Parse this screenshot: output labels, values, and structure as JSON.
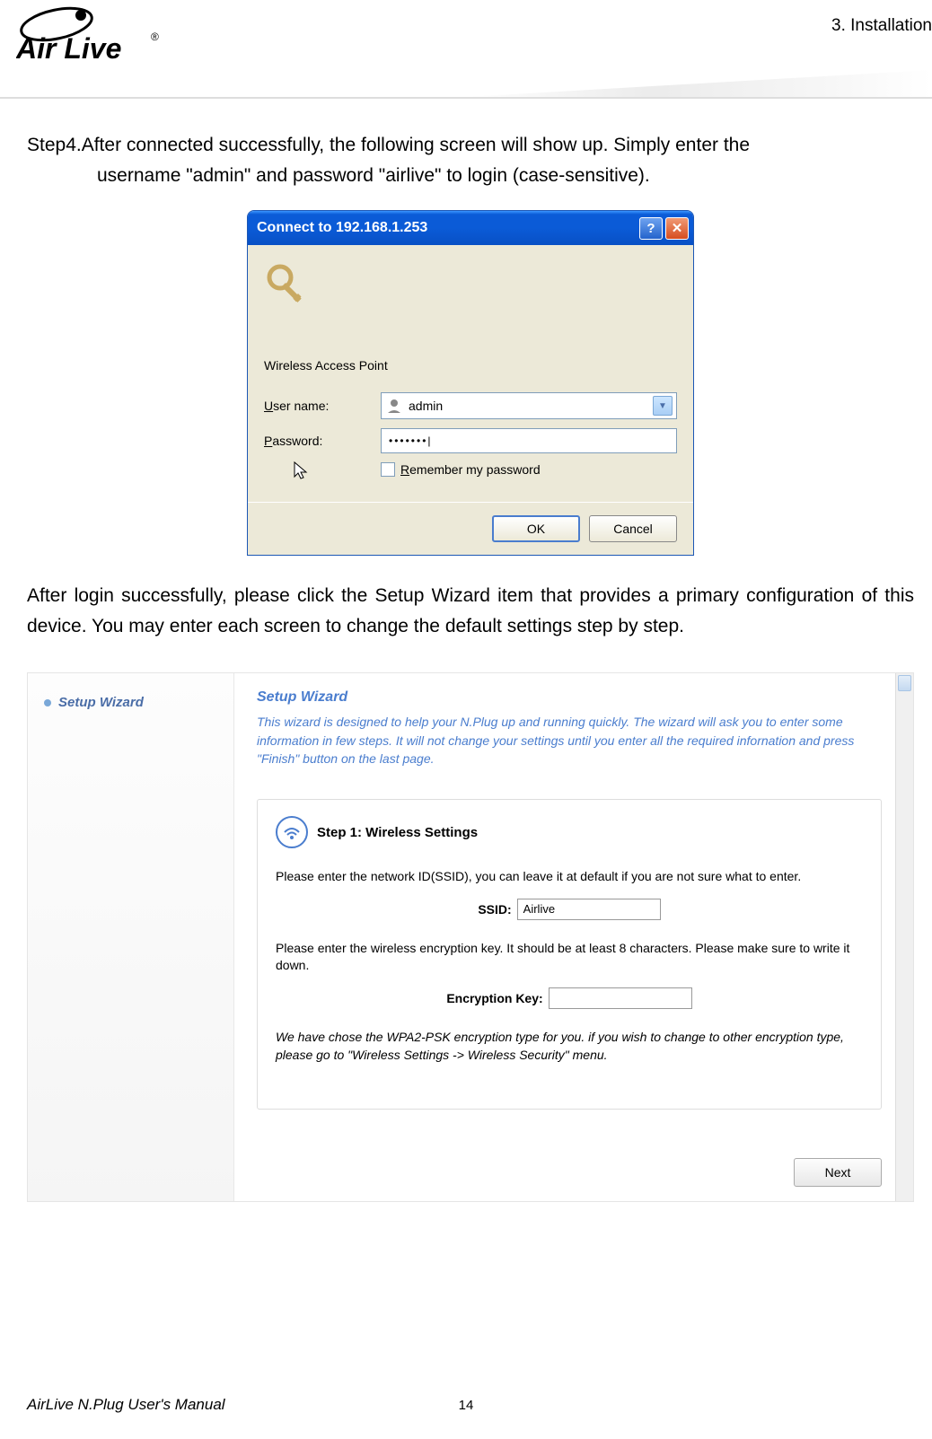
{
  "header": {
    "chapter": "3.  Installation",
    "logo_text": "Air Live",
    "logo_reg": "®"
  },
  "body": {
    "step4_prefix": "Step4. ",
    "step4_line1": "After connected successfully, the following screen will show up. Simply enter the",
    "step4_line2": "username \"admin\" and password \"airlive\" to login (case-sensitive).",
    "after_login": "After login successfully, please click the Setup Wizard item that provides a primary configuration of this device. You may enter each screen to change the default settings step by step."
  },
  "dialog": {
    "title": "Connect to 192.168.1.253",
    "help": "?",
    "close": "✕",
    "server_line": "Wireless Access Point",
    "username_label_u": "U",
    "username_label_rest": "ser name:",
    "username_value": "admin",
    "password_label_u": "P",
    "password_label_rest": "assword:",
    "password_value": "•••••••",
    "password_caret": "|",
    "remember_u": "R",
    "remember_rest": "emember my password",
    "ok": "OK",
    "cancel": "Cancel"
  },
  "wizard": {
    "sidebar_item": "Setup Wizard",
    "title": "Setup Wizard",
    "intro": "This wizard is designed to help your N.Plug up and running quickly. The wizard will ask you to enter some information in few steps. It will not change your settings until you enter all the required infornation and press \"Finish\" button on the last page.",
    "step_title": "Step 1: Wireless Settings",
    "ssid_instruction": "Please enter the network ID(SSID), you can leave it at default if you are not sure what to enter.",
    "ssid_label": "SSID:",
    "ssid_value": "Airlive",
    "key_instruction": "Please enter the wireless encryption key. It should be at least 8 characters. Please make sure to write it down.",
    "key_label": "Encryption Key:",
    "key_value": "",
    "note": "We have chose the WPA2-PSK encryption type for you.  if you wish to change to other encryption type, please go to \"Wireless Settings -> Wireless Security\" menu.",
    "next": "Next"
  },
  "footer": {
    "manual": "AirLive N.Plug User's Manual",
    "page": "14"
  }
}
